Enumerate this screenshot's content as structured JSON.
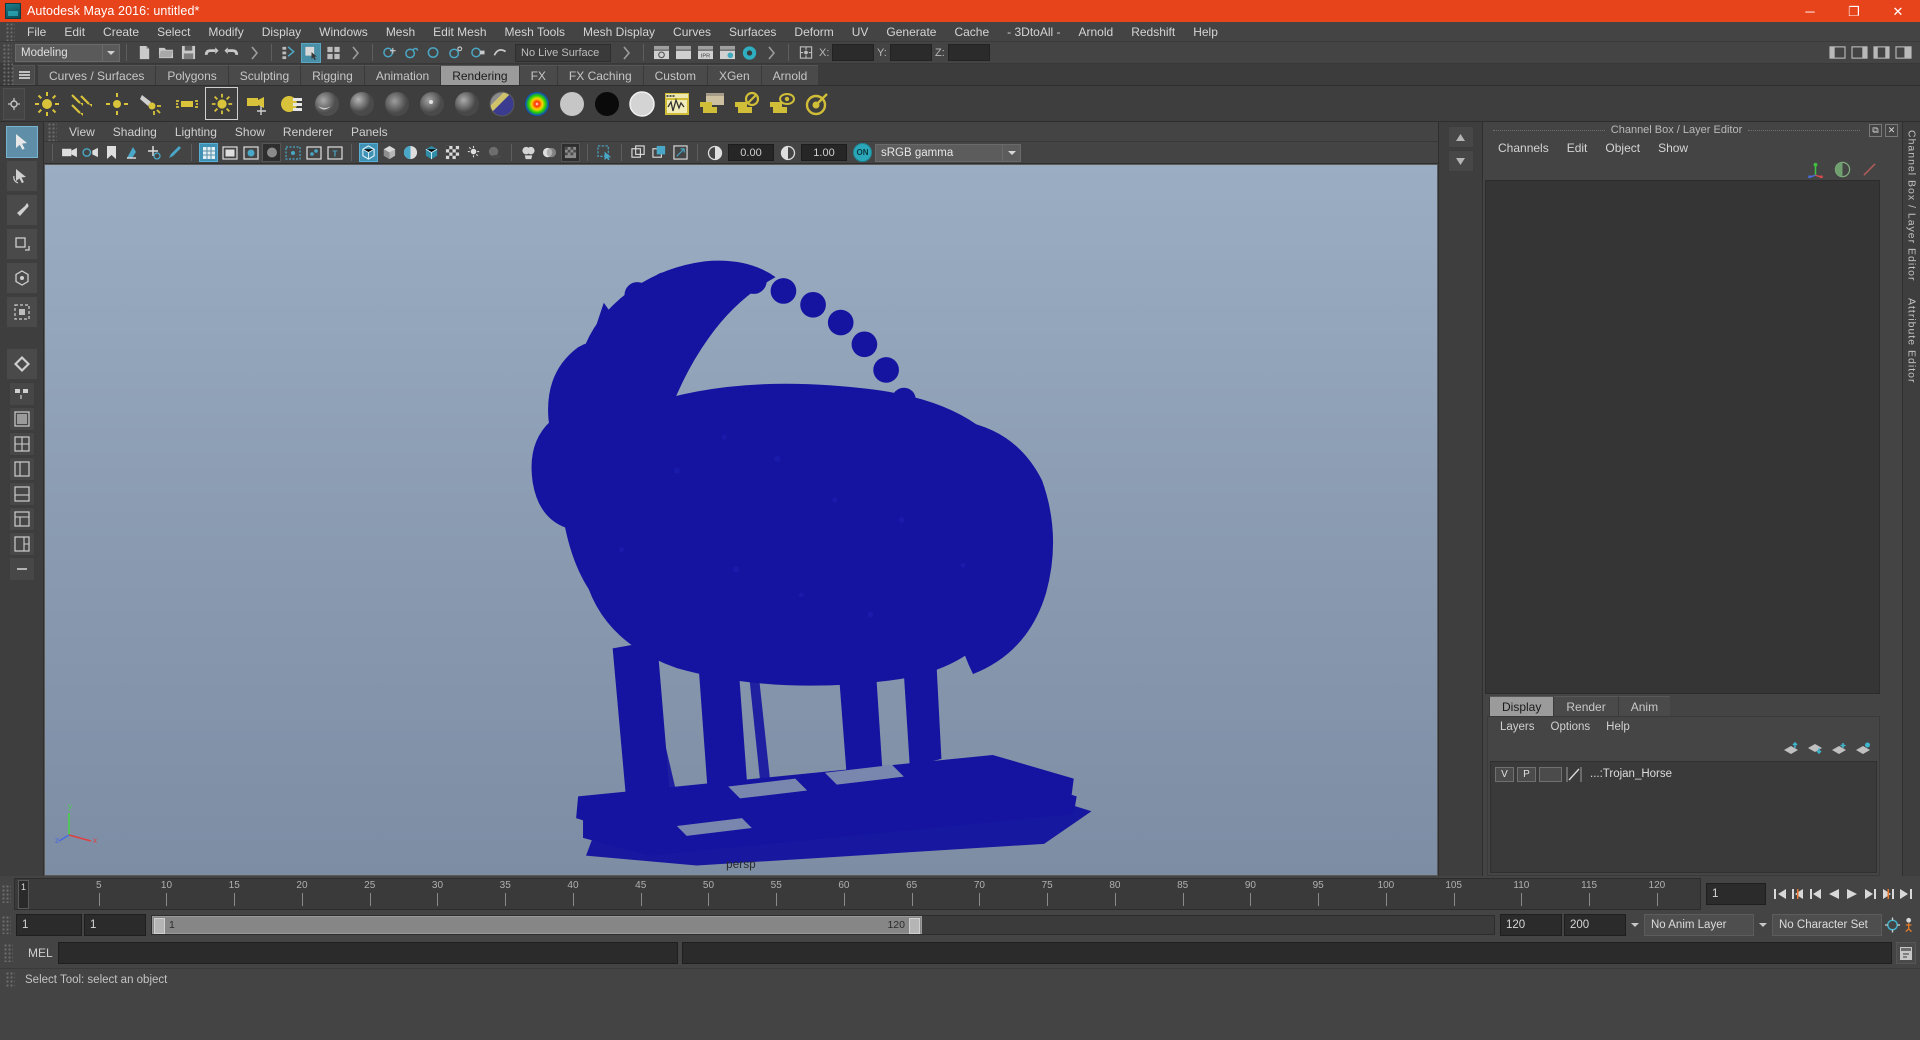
{
  "window": {
    "title": "Autodesk Maya 2016: untitled*",
    "icon": "maya-app-icon",
    "minimize": "─",
    "maximize": "❐",
    "close": "✕"
  },
  "menubar": {
    "items": [
      {
        "label": "File"
      },
      {
        "label": "Edit"
      },
      {
        "label": "Create"
      },
      {
        "label": "Select"
      },
      {
        "label": "Modify"
      },
      {
        "label": "Display"
      },
      {
        "label": "Windows"
      },
      {
        "label": "Mesh"
      },
      {
        "label": "Edit Mesh"
      },
      {
        "label": "Mesh Tools"
      },
      {
        "label": "Mesh Display"
      },
      {
        "label": "Curves"
      },
      {
        "label": "Surfaces"
      },
      {
        "label": "Deform"
      },
      {
        "label": "UV"
      },
      {
        "label": "Generate"
      },
      {
        "label": "Cache"
      },
      {
        "label": "- 3DtoAll -"
      },
      {
        "label": "Arnold"
      },
      {
        "label": "Redshift"
      },
      {
        "label": "Help"
      }
    ]
  },
  "statusline": {
    "menu_set": "Modeling",
    "live_surface": "No Live Surface",
    "x_label": "X:",
    "y_label": "Y:",
    "z_label": "Z:",
    "x_value": "",
    "y_value": "",
    "z_value": ""
  },
  "shelf": {
    "tabs": [
      {
        "label": "Curves / Surfaces",
        "active": false
      },
      {
        "label": "Polygons",
        "active": false
      },
      {
        "label": "Sculpting",
        "active": false
      },
      {
        "label": "Rigging",
        "active": false
      },
      {
        "label": "Animation",
        "active": false
      },
      {
        "label": "Rendering",
        "active": true
      },
      {
        "label": "FX",
        "active": false
      },
      {
        "label": "FX Caching",
        "active": false
      },
      {
        "label": "Custom",
        "active": false
      },
      {
        "label": "XGen",
        "active": false
      },
      {
        "label": "Arnold",
        "active": false
      }
    ],
    "icons": [
      "ambient-light-icon",
      "directional-light-icon",
      "point-light-icon",
      "spot-light-icon",
      "area-light-icon",
      "volume-light-icon",
      "camera-aim-icon",
      "render-settings-icon",
      "lambert-material-icon",
      "blinn-material-icon",
      "phong-material-icon",
      "phonge-material-icon",
      "anisotropic-material-icon",
      "layered-shader-icon",
      "ramp-shader-icon",
      "surface-shader-icon",
      "use-background-icon",
      "shading-map-icon",
      "hypershade-icon",
      "render-view-icon",
      "render-current-frame-icon",
      "ipr-render-icon",
      "render-sequence-icon"
    ]
  },
  "viewport": {
    "panel_menu": [
      "View",
      "Shading",
      "Lighting",
      "Show",
      "Renderer",
      "Panels"
    ],
    "exposure_value": "0.00",
    "gamma_value": "1.00",
    "color_management": "sRGB gamma",
    "gamma_toggle": "ON",
    "camera_label": "persp",
    "model_color": "#1414a0",
    "bg_top": "#9aadc2",
    "bg_bottom": "#7d8da4"
  },
  "dock": {
    "title": "Channel Box / Layer Editor",
    "float_btn": "⧉",
    "close_btn": "✕",
    "menu": [
      "Channels",
      "Edit",
      "Object",
      "Show"
    ],
    "vertical_tabs": [
      "Channel Box / Layer Editor",
      "Attribute Editor"
    ]
  },
  "layer_editor": {
    "tabs": [
      {
        "label": "Display",
        "active": true
      },
      {
        "label": "Render",
        "active": false
      },
      {
        "label": "Anim",
        "active": false
      }
    ],
    "menu": [
      "Layers",
      "Options",
      "Help"
    ],
    "buttons": [
      "move-layer-up-icon",
      "move-layer-down-icon",
      "new-layer-icon",
      "new-layer-from-selected-icon"
    ],
    "rows": [
      {
        "visibility": "V",
        "playback": "P",
        "shading": "",
        "name": "...:Trojan_Horse"
      }
    ]
  },
  "timeline": {
    "ticks": [
      5,
      10,
      15,
      20,
      25,
      30,
      35,
      40,
      45,
      50,
      55,
      60,
      65,
      70,
      75,
      80,
      85,
      90,
      95,
      100,
      105,
      110,
      115,
      120
    ],
    "current_frame": "1",
    "current_frame_field": "1",
    "playhead_label": "1",
    "playback_buttons": [
      "go-to-start-icon",
      "step-back-key-icon",
      "step-back-frame-icon",
      "play-backwards-icon",
      "play-forwards-icon",
      "step-forward-frame-icon",
      "step-forward-key-icon",
      "go-to-end-icon"
    ]
  },
  "range": {
    "start_field": "1",
    "anim_start_field": "1",
    "range_start": "1",
    "range_end": "120",
    "anim_end_field": "120",
    "playback_end_field": "200",
    "anim_layer": "No Anim Layer",
    "character_set": "No Character Set"
  },
  "command_line": {
    "label": "MEL",
    "input_value": "",
    "output_value": "",
    "script_editor_btn": "script-editor-icon"
  },
  "status": {
    "message": "Select Tool: select an object"
  }
}
